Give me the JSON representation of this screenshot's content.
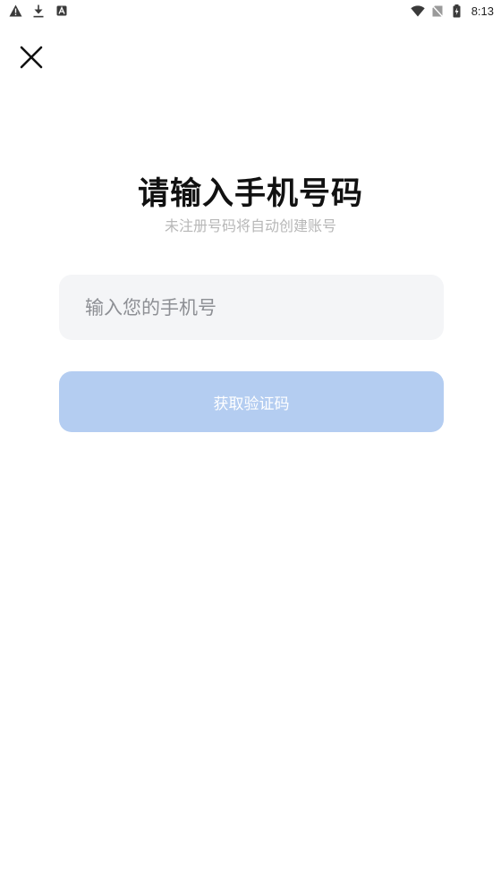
{
  "status_bar": {
    "time": "8:13",
    "left_icons": [
      "warning-icon",
      "download-icon",
      "app-notification-icon"
    ],
    "right_icons": [
      "wifi-icon",
      "no-sim-icon",
      "battery-charging-icon"
    ]
  },
  "header": {
    "close_icon": "close-icon"
  },
  "main": {
    "title": "请输入手机号码",
    "subtitle": "未注册号码将自动创建账号",
    "phone_input": {
      "placeholder": "输入您的手机号",
      "value": ""
    },
    "get_code_button": {
      "label": "获取验证码"
    }
  },
  "colors": {
    "background": "#ffffff",
    "input_background": "#f4f5f7",
    "button_disabled": "#b4cdf1",
    "title": "#111111",
    "subtitle": "#b7b7b7",
    "placeholder": "#8d8f94"
  }
}
